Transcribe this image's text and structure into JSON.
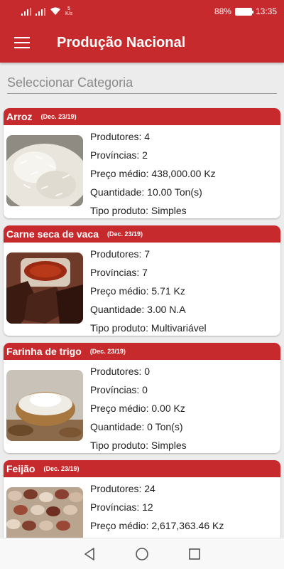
{
  "status_bar": {
    "net_speed_value": "5",
    "net_speed_unit": "K/s",
    "battery": "88%",
    "time": "13:35"
  },
  "app_bar": {
    "title": "Produção Nacional"
  },
  "category_select": {
    "placeholder": "Seleccionar Categoria"
  },
  "products": [
    {
      "name": "Arroz",
      "dec": "(Dec. 23/19)",
      "produtores": "Produtores: 4",
      "provincias": "Províncias: 2",
      "preco": "Preço médio: 438,000.00 Kz",
      "quantidade": "Quantidade: 10.00 Ton(s)",
      "tipo": "Tipo produto: Simples"
    },
    {
      "name": "Carne seca de vaca",
      "dec": "(Dec. 23/19)",
      "produtores": "Produtores: 7",
      "provincias": "Províncias: 7",
      "preco": "Preço médio: 5.71 Kz",
      "quantidade": "Quantidade: 3.00 N.A",
      "tipo": "Tipo produto: Multivariável"
    },
    {
      "name": "Farinha de trigo",
      "dec": "(Dec. 23/19)",
      "produtores": "Produtores: 0",
      "provincias": "Províncias: 0",
      "preco": "Preço médio: 0.00 Kz",
      "quantidade": "Quantidade: 0 Ton(s)",
      "tipo": "Tipo produto: Simples"
    },
    {
      "name": "Feijão",
      "dec": "(Dec. 23/19)",
      "produtores": "Produtores: 24",
      "provincias": "Províncias: 12",
      "preco": "Preço médio: 2,617,363.46 Kz",
      "quantidade": "",
      "tipo": ""
    }
  ],
  "colors": {
    "primary": "#c72a2d",
    "background": "#ececec"
  }
}
